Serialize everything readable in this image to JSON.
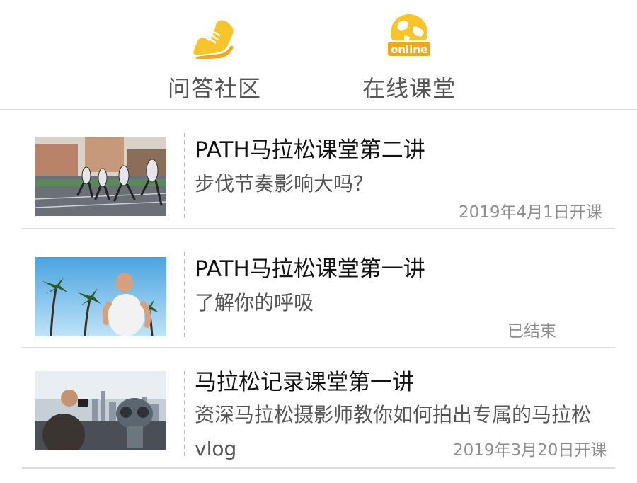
{
  "nav": {
    "qa": {
      "label": "问答社区",
      "icon": "sneaker-icon"
    },
    "online": {
      "label": "在线课堂",
      "icon": "online-globe-icon",
      "badge": "online"
    }
  },
  "colors": {
    "accent": "#F7C52A",
    "accent_dark": "#F0A81C",
    "divider": "#DCDCDC"
  },
  "courses": [
    {
      "title": "PATH马拉松课堂第二讲",
      "desc": "步伐节奏影响大吗？",
      "status": "2019年4月1日开课",
      "thumb": "runners-on-track"
    },
    {
      "title": "PATH马拉松课堂第一讲",
      "desc": "了解你的呼吸",
      "status": "已结束",
      "thumb": "runner-palm-trees"
    },
    {
      "title": "马拉松记录课堂第一讲",
      "desc": "资深马拉松摄影师教你如何拍出专属的马拉松vlog",
      "status": "2019年3月20日开课",
      "thumb": "photographer-city-viewer"
    }
  ]
}
